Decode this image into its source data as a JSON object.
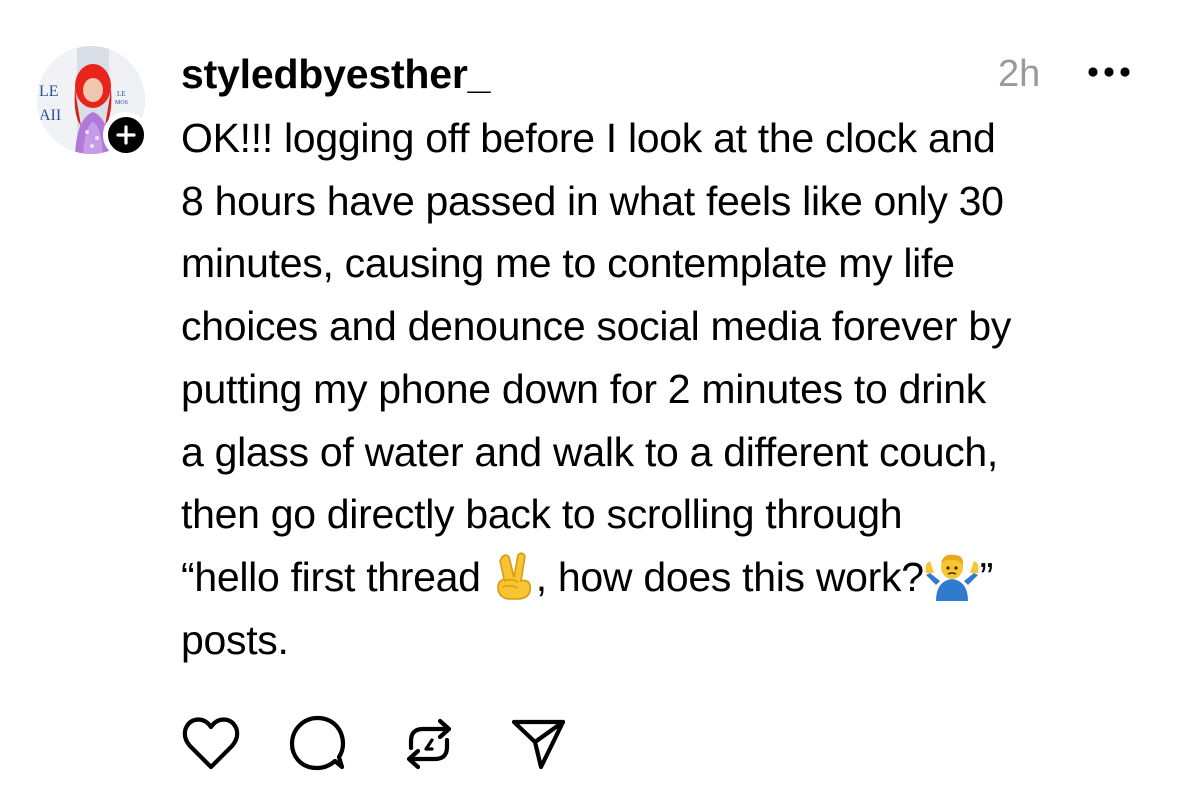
{
  "post": {
    "username": "styledbyesther_",
    "timestamp": "2h",
    "avatar_icon": "profile-avatar",
    "follow_icon": "plus-icon",
    "more_icon": "more-options-icon",
    "body_lines": [
      [
        "OK!!! logging off before I look at the clock and"
      ],
      [
        "8 hours have passed in what feels like only 30"
      ],
      [
        "minutes, causing me to contemplate my life"
      ],
      [
        "choices and denounce social media forever by"
      ],
      [
        "putting my phone down for 2 minutes to drink"
      ],
      [
        "a glass of water and walk to a different couch,"
      ],
      [
        "then go directly back to scrolling through"
      ],
      [
        "“hello first thread ",
        ", how does this work?",
        "”"
      ],
      [
        "posts."
      ]
    ],
    "emojis": [
      "victory-hand-emoji",
      "person-shrugging-emoji"
    ],
    "actions": [
      "like-icon",
      "comment-icon",
      "repost-icon",
      "share-icon"
    ]
  },
  "colors": {
    "text": "#000000",
    "timestamp": "#9a9a9a",
    "background": "#ffffff",
    "badge": "#000000"
  }
}
